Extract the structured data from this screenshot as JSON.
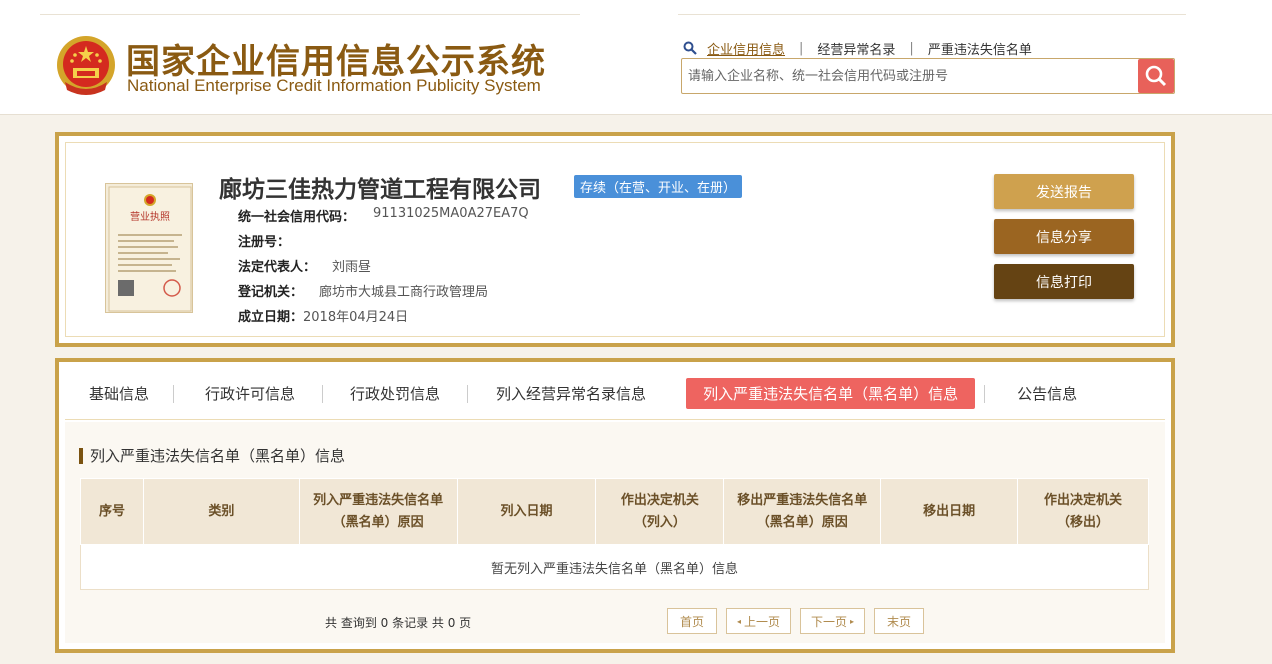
{
  "header": {
    "title_cn": "国家企业信用信息公示系统",
    "title_en": "National Enterprise Credit Information Publicity System",
    "nav": {
      "credit_info": "企业信用信息",
      "abnormal_list": "经营异常名录",
      "blacklist": "严重违法失信名单"
    },
    "search": {
      "placeholder": "请输入企业名称、统一社会信用代码或注册号",
      "icon": "search-icon"
    }
  },
  "company": {
    "name": "廊坊三佳热力管道工程有限公司",
    "status": "存续（在营、开业、在册）",
    "fields": [
      {
        "label": "统一社会信用代码：",
        "value": "91131025MA0A27EA7Q"
      },
      {
        "label": "注册号：",
        "value": ""
      },
      {
        "label": "法定代表人：",
        "value": "刘雨昼"
      },
      {
        "label": "登记机关：",
        "value": "廊坊市大城县工商行政管理局"
      },
      {
        "label": "成立日期：",
        "value": "2018年04月24日"
      }
    ],
    "license_title": "营业执照",
    "actions": {
      "send_report": "发送报告",
      "share": "信息分享",
      "print": "信息打印"
    },
    "colors": {
      "send_report": "#cfa14e",
      "share": "#9b6521",
      "print": "#654313",
      "status_badge": "#4a90d9"
    }
  },
  "tabs": [
    {
      "label": "基础信息",
      "active": false
    },
    {
      "label": "行政许可信息",
      "active": false
    },
    {
      "label": "行政处罚信息",
      "active": false
    },
    {
      "label": "列入经营异常名录信息",
      "active": false
    },
    {
      "label": "列入严重违法失信名单（黑名单）信息",
      "active": true
    },
    {
      "label": "公告信息",
      "active": false
    }
  ],
  "section": {
    "title": "列入严重违法失信名单（黑名单）信息",
    "columns": [
      "序号",
      "类别",
      "列入严重违法失信名单（黑名单）原因",
      "列入日期",
      "作出决定机关（列入）",
      "移出严重违法失信名单（黑名单）原因",
      "移出日期",
      "作出决定机关（移出）"
    ],
    "empty_text": "暂无列入严重违法失信名单（黑名单）信息"
  },
  "pagination": {
    "summary": "共 查询到 0 条记录 共 0 页",
    "first": "首页",
    "prev": "上一页",
    "next": "下一页",
    "last": "末页"
  },
  "accent": "#c9a24a"
}
